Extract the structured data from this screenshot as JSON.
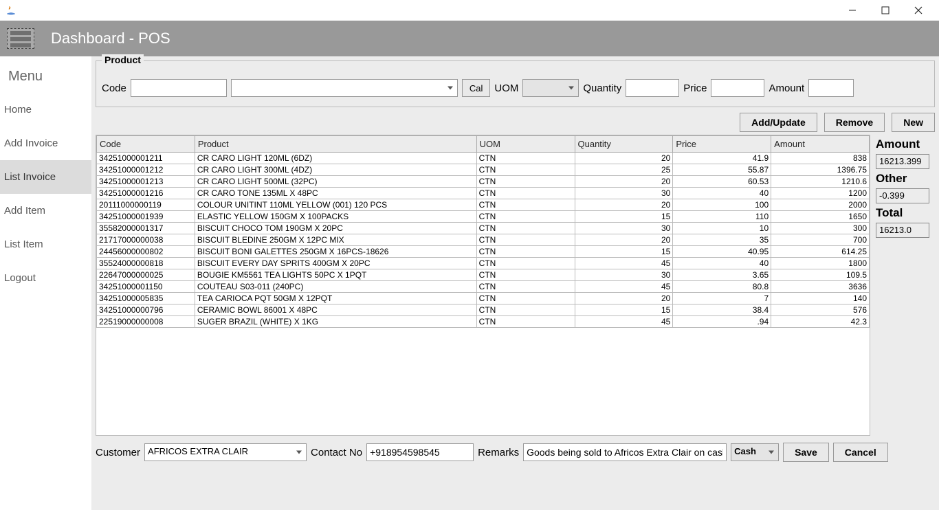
{
  "window": {
    "title": ""
  },
  "toolbar": {
    "title": "Dashboard - POS"
  },
  "sidebar": {
    "header": "Menu",
    "items": [
      {
        "label": "Home",
        "id": "home"
      },
      {
        "label": "Add Invoice",
        "id": "add-invoice"
      },
      {
        "label": "List Invoice",
        "id": "list-invoice",
        "active": true
      },
      {
        "label": "Add Item",
        "id": "add-item"
      },
      {
        "label": "List Item",
        "id": "list-item"
      },
      {
        "label": "Logout",
        "id": "logout"
      }
    ]
  },
  "product": {
    "legend": "Product",
    "code_label": "Code",
    "code_value": "",
    "name_value": "",
    "cal_label": "Cal",
    "uom_label": "UOM",
    "uom_value": "",
    "qty_label": "Quantity",
    "qty_value": "",
    "price_label": "Price",
    "price_value": "",
    "amount_label": "Amount",
    "amount_value": ""
  },
  "actions": {
    "add_update": "Add/Update",
    "remove": "Remove",
    "new": "New"
  },
  "table": {
    "headers": [
      "Code",
      "Product",
      "UOM",
      "Quantity",
      "Price",
      "Amount"
    ],
    "rows": [
      {
        "code": "34251000001211",
        "product": "CR CARO LIGHT 120ML (6DZ)",
        "uom": "CTN",
        "qty": "20",
        "price": "41.9",
        "amount": "838"
      },
      {
        "code": "34251000001212",
        "product": "CR CARO LIGHT 300ML (4DZ)",
        "uom": "CTN",
        "qty": "25",
        "price": "55.87",
        "amount": "1396.75"
      },
      {
        "code": "34251000001213",
        "product": "CR CARO LIGHT 500ML (32PC)",
        "uom": "CTN",
        "qty": "20",
        "price": "60.53",
        "amount": "1210.6"
      },
      {
        "code": "34251000001216",
        "product": "CR CARO TONE 135ML X 48PC",
        "uom": "CTN",
        "qty": "30",
        "price": "40",
        "amount": "1200"
      },
      {
        "code": "20111000000119",
        "product": "COLOUR UNITINT 110ML YELLOW (001) 120 PCS",
        "uom": "CTN",
        "qty": "20",
        "price": "100",
        "amount": "2000"
      },
      {
        "code": "34251000001939",
        "product": "ELASTIC YELLOW 150GM X 100PACKS",
        "uom": "CTN",
        "qty": "15",
        "price": "110",
        "amount": "1650"
      },
      {
        "code": "35582000001317",
        "product": "BISCUIT  CHOCO TOM 190GM X 20PC",
        "uom": "CTN",
        "qty": "30",
        "price": "10",
        "amount": "300"
      },
      {
        "code": "21717000000038",
        "product": "BISCUIT BLEDINE 250GM X 12PC MIX",
        "uom": "CTN",
        "qty": "20",
        "price": "35",
        "amount": "700"
      },
      {
        "code": "24456000000802",
        "product": "BISCUIT BONI GALETTES 250GM X 16PCS-18626",
        "uom": "CTN",
        "qty": "15",
        "price": "40.95",
        "amount": "614.25"
      },
      {
        "code": "35524000000818",
        "product": "BISCUIT EVERY DAY SPRITS 400GM X 20PC",
        "uom": "CTN",
        "qty": "45",
        "price": "40",
        "amount": "1800"
      },
      {
        "code": "22647000000025",
        "product": "BOUGIE KM5561 TEA LIGHTS 50PC X 1PQT",
        "uom": "CTN",
        "qty": "30",
        "price": "3.65",
        "amount": "109.5"
      },
      {
        "code": "34251000001150",
        "product": "COUTEAU S03-011 (240PC)",
        "uom": "CTN",
        "qty": "45",
        "price": "80.8",
        "amount": "3636"
      },
      {
        "code": "34251000005835",
        "product": "TEA CARIOCA PQT 50GM X 12PQT",
        "uom": "CTN",
        "qty": "20",
        "price": "7",
        "amount": "140"
      },
      {
        "code": "34251000000796",
        "product": "CERAMIC BOWL 86001 X 48PC",
        "uom": "CTN",
        "qty": "15",
        "price": "38.4",
        "amount": "576"
      },
      {
        "code": "22519000000008",
        "product": "SUGER BRAZIL (WHITE) X 1KG",
        "uom": "CTN",
        "qty": "45",
        "price": ".94",
        "amount": "42.3"
      }
    ]
  },
  "totals": {
    "amount_label": "Amount",
    "amount_value": "16213.399",
    "other_label": "Other",
    "other_value": "-0.399",
    "total_label": "Total",
    "total_value": "16213.0"
  },
  "footer": {
    "customer_label": "Customer",
    "customer_value": "AFRICOS EXTRA CLAIR",
    "contact_label": "Contact No",
    "contact_value": "+918954598545",
    "remarks_label": "Remarks",
    "remarks_value": "Goods being sold to Africos Extra Clair on cash.",
    "payment_value": "Cash",
    "save_label": "Save",
    "cancel_label": "Cancel"
  }
}
